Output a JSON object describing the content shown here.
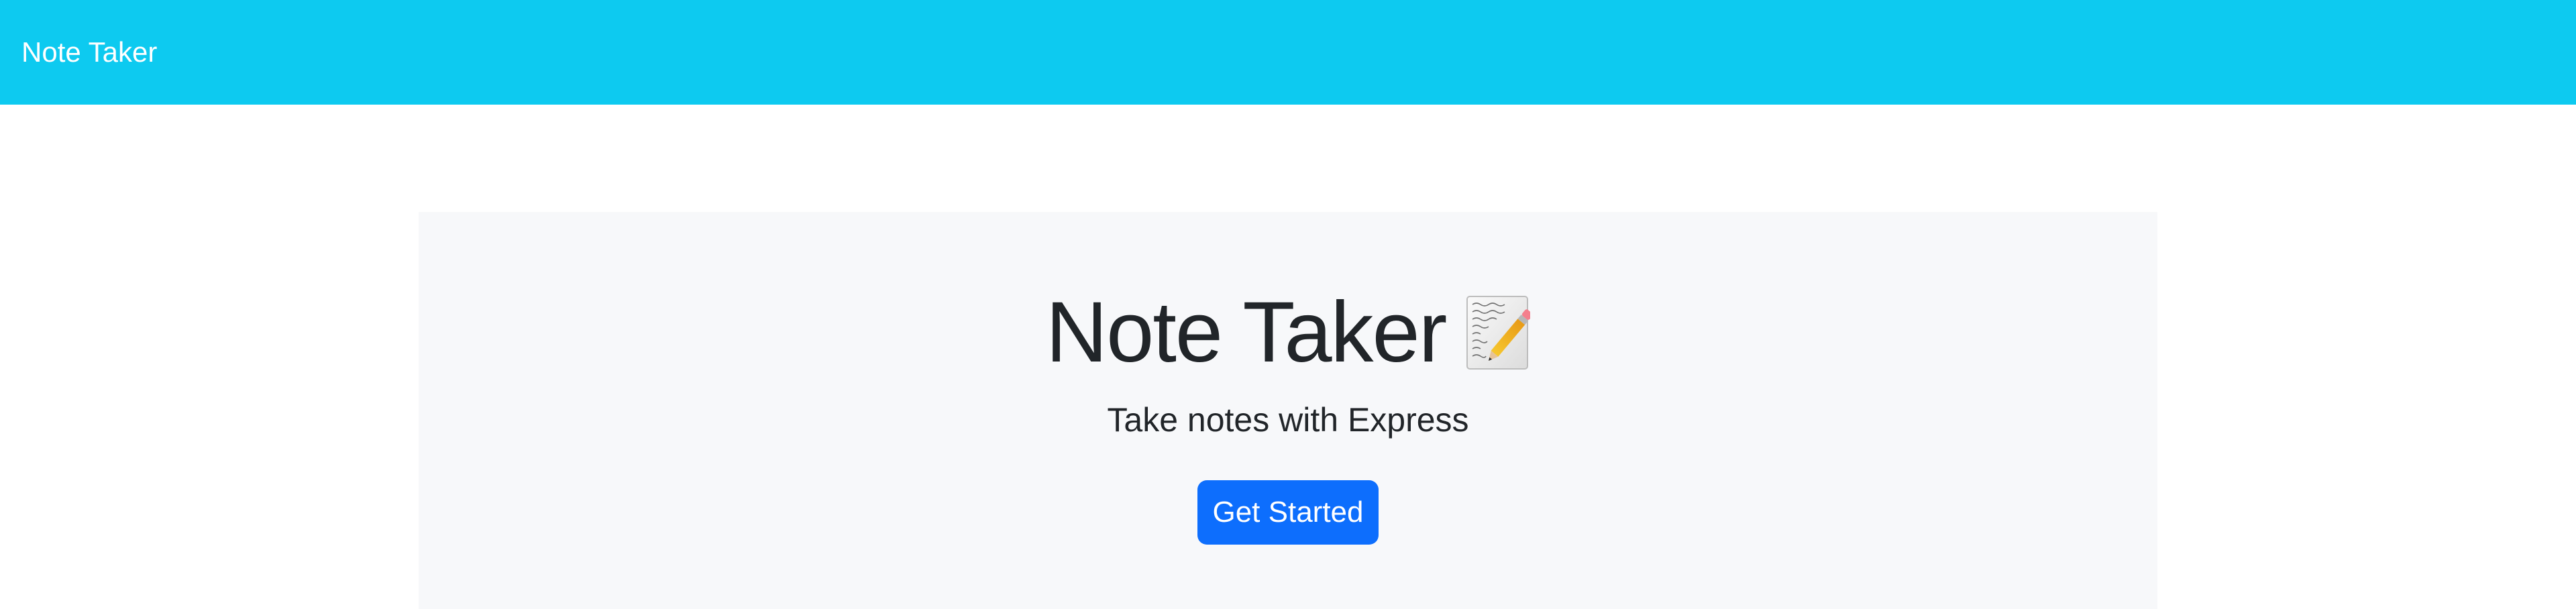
{
  "navbar": {
    "brand": "Note Taker",
    "background": "#0dcaf0"
  },
  "hero": {
    "title": "Note Taker",
    "title_icon": "memo-icon",
    "subtitle": "Take notes with Express",
    "button_label": "Get Started",
    "button_color": "#0d6efd",
    "panel_color": "#f7f8fa"
  }
}
